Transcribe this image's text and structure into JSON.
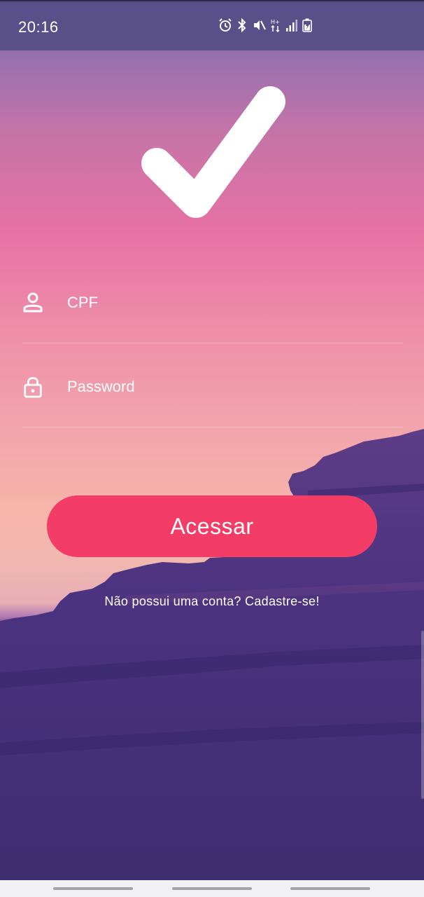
{
  "status_bar": {
    "time": "20:16",
    "icons": [
      "alarm-icon",
      "bluetooth-icon",
      "mute-icon",
      "data-activity-icon",
      "signal-icon",
      "battery-charging-icon"
    ]
  },
  "logo": {
    "icon": "checkmark-icon"
  },
  "form": {
    "cpf": {
      "icon": "person-icon",
      "placeholder": "CPF",
      "value": ""
    },
    "password": {
      "icon": "lock-icon",
      "placeholder": "Password",
      "value": ""
    }
  },
  "login_button": {
    "label": "Acessar"
  },
  "signup_link": {
    "text": "Não possui uma conta? Cadastre-se!"
  },
  "colors": {
    "button": "#f33d67",
    "status_bar": "#59508a",
    "gradient_top": "#8e70b0",
    "gradient_mid": "#e771a4",
    "gradient_bottom": "#f6b4aa",
    "landscape": "#3e2e70"
  },
  "nav_bar": {
    "buttons": [
      "recents-button",
      "home-button",
      "back-button"
    ]
  }
}
